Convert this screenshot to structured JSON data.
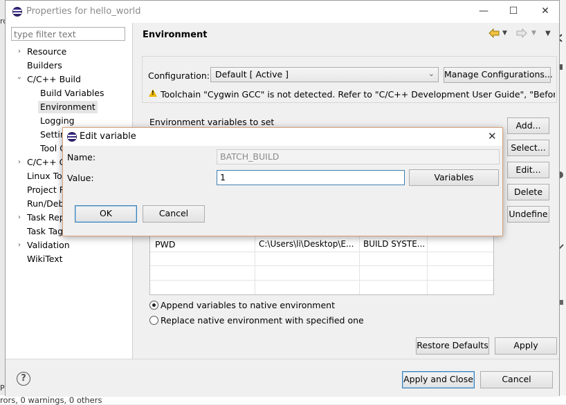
{
  "window": {
    "title": "Properties for hello_world",
    "minimize": "—",
    "maximize": "☐",
    "close": "✕"
  },
  "filter": {
    "placeholder": "type filter text"
  },
  "tree": [
    {
      "label": "Resource",
      "expander": "›"
    },
    {
      "label": "Builders"
    },
    {
      "label": "C/C++ Build",
      "expander": "⌄"
    },
    {
      "label": "Build Variables"
    },
    {
      "label": "Environment"
    },
    {
      "label": "Logging"
    },
    {
      "label": "Settin"
    },
    {
      "label": "Tool C"
    },
    {
      "label": "C/C++ G",
      "expander": "›"
    },
    {
      "label": "Linux Too"
    },
    {
      "label": "Project R"
    },
    {
      "label": "Run/Debu"
    },
    {
      "label": "Task Rep",
      "expander": "›"
    },
    {
      "label": "Task Tag"
    },
    {
      "label": "Validation",
      "expander": "›"
    },
    {
      "label": "WikiText"
    }
  ],
  "page": {
    "title": "Environment",
    "configuration_label": "Configuration:",
    "configuration_value": "Default  [ Active ]",
    "manage_button": "Manage Configurations...",
    "warning": "Toolchain \"Cygwin GCC\" is not detected. Refer to \"C/C++ Development User Guide\", \"Before you",
    "env_label": "Environment variables to set",
    "side_buttons": [
      "Add...",
      "Select...",
      "Edit...",
      "Delete",
      "Undefine"
    ],
    "table_row": {
      "name": "PWD",
      "value": "C:\\Users\\li\\Desktop\\E...",
      "origin": "BUILD SYSTE..."
    },
    "radio_append": "Append variables to native environment",
    "radio_replace": "Replace native environment with specified one",
    "restore_button": "Restore Defaults",
    "apply_button": "Apply"
  },
  "footer": {
    "apply_close": "Apply and Close",
    "cancel": "Cancel",
    "help": "?"
  },
  "dialog": {
    "title": "Edit variable",
    "close": "✕",
    "name_label": "Name:",
    "name_value": "BATCH_BUILD",
    "value_label": "Value:",
    "value_value": "1",
    "variables_button": "Variables",
    "ok": "OK",
    "cancel": "Cancel"
  },
  "background": {
    "status_text": "rors, 0 warnings, 0 others",
    "left_mark_top": "ro",
    "left_mark_bottom": "P"
  }
}
